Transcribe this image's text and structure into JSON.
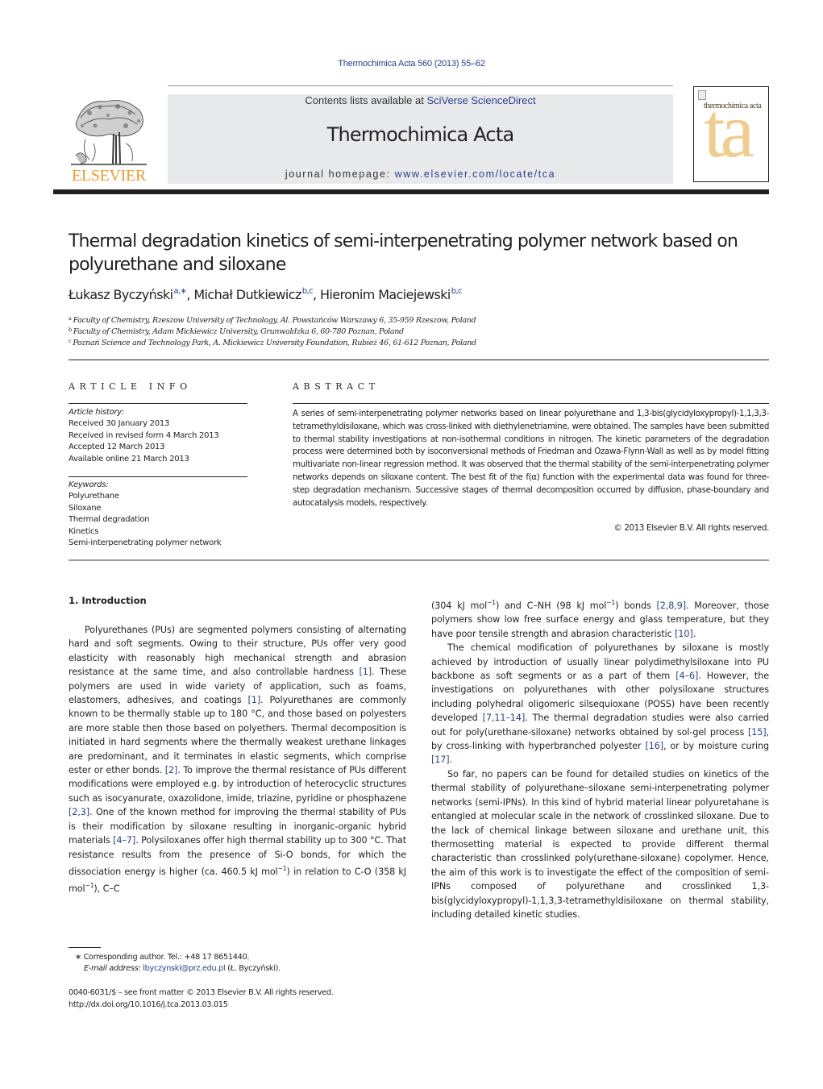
{
  "header": {
    "citation": "Thermochimica Acta 560 (2013) 55–62",
    "contents_prefix": "Contents lists available at ",
    "contents_link": "SciVerse ScienceDirect",
    "journal_title": "Thermochimica Acta",
    "homepage_prefix": "journal homepage: ",
    "homepage_link": "www.elsevier.com/locate/tca",
    "publisher_logo_text": "ELSEVIER",
    "cover_title": "thermochimica acta",
    "cover_letters": "ta"
  },
  "article": {
    "title": "Thermal degradation kinetics of semi-interpenetrating polymer network based on polyurethane and siloxane",
    "authors": [
      {
        "name": "Łukasz Byczyński",
        "affil": "a,∗",
        "sep": ", "
      },
      {
        "name": "Michał Dutkiewicz",
        "affil": "b,c",
        "sep": ", "
      },
      {
        "name": "Hieronim Maciejewski",
        "affil": "b,c",
        "sep": ""
      }
    ],
    "affiliations": [
      {
        "mark": "a",
        "text": "Faculty of Chemistry, Rzeszow University of Technology, Al. Powstańców Warszawy 6, 35-959 Rzeszow, Poland"
      },
      {
        "mark": "b",
        "text": "Faculty of Chemistry, Adam Mickiewicz University, Grunwaldzka 6, 60-780 Poznan, Poland"
      },
      {
        "mark": "c",
        "text": "Poznań Science and Technology Park, A. Mickiewicz University Foundation, Rubież 46, 61-612 Poznan, Poland"
      }
    ]
  },
  "article_info": {
    "heading": "ARTICLE INFO",
    "history_label": "Article history:",
    "history": [
      "Received 30 January 2013",
      "Received in revised form 4 March 2013",
      "Accepted 12 March 2013",
      "Available online 21 March 2013"
    ],
    "keywords_label": "Keywords:",
    "keywords": [
      "Polyurethane",
      "Siloxane",
      "Thermal degradation",
      "Kinetics",
      "Semi-interpenetrating polymer network"
    ]
  },
  "abstract": {
    "heading": "ABSTRACT",
    "text": "A series of semi-interpenetrating polymer networks based on linear polyurethane and 1,3-bis(glycidyloxypropyl)-1,1,3,3-tetramethyldisiloxane, which was cross-linked with diethylenetriamine, were obtained. The samples have been submitted to thermal stability investigations at non-isothermal conditions in nitrogen. The kinetic parameters of the degradation process were determined both by isoconversional methods of Friedman and Ozawa-Flynn-Wall as well as by model fitting multivariate non-linear regression method. It was observed that the thermal stability of the semi-interpenetrating polymer networks depends on siloxane content. The best fit of the f(α) function with the experimental data was found for three-step degradation mechanism. Successive stages of thermal decomposition occurred by diffusion, phase-boundary and autocatalysis models, respectively.",
    "copyright": "© 2013 Elsevier B.V. All rights reserved."
  },
  "introduction": {
    "heading": "1.  Introduction",
    "left_paragraphs": [
      [
        {
          "t": "Polyurethanes (PUs) are segmented polymers consisting of alternating hard and soft segments. Owing to their structure, PUs offer very good elasticity with reasonably high mechanical strength and abrasion resistance at the same time, and also controllable hardness "
        },
        {
          "c": "[1]"
        },
        {
          "t": ". These polymers are used in wide variety of application, such as foams, elastomers, adhesives, and coatings "
        },
        {
          "c": "[1]"
        },
        {
          "t": ". Polyurethanes are commonly known to be thermally stable up to 180 °C, and those based on polyesters are more stable then those based on polyethers. Thermal decomposition is initiated in hard segments where the thermally weakest urethane linkages are predominant, and it terminates in elastic segments, which comprise ester or ether bonds. "
        },
        {
          "c": "[2]"
        },
        {
          "t": ". To improve the thermal resistance of PUs different modifications were employed e.g. by introduction of heterocyclic structures such as isocyanurate, oxazolidone, imide, triazine, pyridine or phosphazene "
        },
        {
          "c": "[2,3]"
        },
        {
          "t": ". One of the known method for improving the thermal stability of PUs is their modification by siloxane resulting in inorganic-organic hybrid materials "
        },
        {
          "c": "[4–7]"
        },
        {
          "t": ". Polysiloxanes offer high thermal stability up to 300 °C. That resistance results from the presence of Si-O bonds, for which the dissociation energy is higher (ca. 460.5 kJ mol"
        },
        {
          "s": "−1"
        },
        {
          "t": ") in relation to C-O (358 kJ mol"
        },
        {
          "s": "−1"
        },
        {
          "t": "), C–C"
        }
      ]
    ],
    "right_paragraphs": [
      {
        "noindent": true,
        "runs": [
          {
            "t": "(304 kJ mol"
          },
          {
            "s": "−1"
          },
          {
            "t": ") and C–NH (98 kJ mol"
          },
          {
            "s": "−1"
          },
          {
            "t": ") bonds "
          },
          {
            "c": "[2,8,9]"
          },
          {
            "t": ". Moreover, those polymers show low free surface energy and glass temperature, but they have poor tensile strength and abrasion characteristic "
          },
          {
            "c": "[10]"
          },
          {
            "t": "."
          }
        ]
      },
      {
        "noindent": false,
        "runs": [
          {
            "t": "The chemical modification of polyurethanes by siloxane is mostly achieved by introduction of usually linear polydimethylsiloxane into PU backbone as soft segments or as a part of them "
          },
          {
            "c": "[4–6]"
          },
          {
            "t": ". However, the investigations on polyurethanes with other polysiloxane structures including polyhedral oligomeric silsequioxane (POSS) have been recently developed "
          },
          {
            "c": "[7,11–14]"
          },
          {
            "t": ". The thermal degradation studies were also carried out for poly(urethane-siloxane) networks obtained by sol-gel process "
          },
          {
            "c": "[15]"
          },
          {
            "t": ", by cross-linking with hyperbranched polyester "
          },
          {
            "c": "[16]"
          },
          {
            "t": ", or by moisture curing "
          },
          {
            "c": "[17]"
          },
          {
            "t": "."
          }
        ]
      },
      {
        "noindent": false,
        "runs": [
          {
            "t": "So far, no papers can be found for detailed studies on kinetics of the thermal stability of polyurethane–siloxane semi-interpenetrating polymer networks (semi-IPNs). In this kind of hybrid material linear polyuretahane is entangled at molecular scale in the network of crosslinked siloxane. Due to the lack of chemical linkage between siloxane and urethane unit, this thermosetting material is expected to provide different thermal characteristic than crosslinked poly(urethane-siloxane) copolymer. Hence, the aim of this work is to investigate the effect of the composition of semi-IPNs composed of polyurethane and crosslinked 1,3-bis(glycidyloxypropyl)-1,1,3,3-tetramethyldisiloxane on thermal stability, including detailed kinetic studies."
          }
        ]
      }
    ]
  },
  "footnotes": {
    "corresponding": "∗ Corresponding author. Tel.: +48 17 8651440.",
    "email_label": "E-mail address: ",
    "email": "lbyczynski@prz.edu.pl",
    "email_suffix": " (Ł. Byczyński).",
    "issn_line": "0040-6031/$ – see front matter © 2013 Elsevier B.V. All rights reserved.",
    "doi": "http://dx.doi.org/10.1016/j.tca.2013.03.015"
  },
  "colors": {
    "link": "#2a3f90",
    "elsevier_orange": "#f29b2f",
    "masthead_bg": "#e8e9ea",
    "cover_accent": "#f0cc8e",
    "text": "#231f20"
  }
}
